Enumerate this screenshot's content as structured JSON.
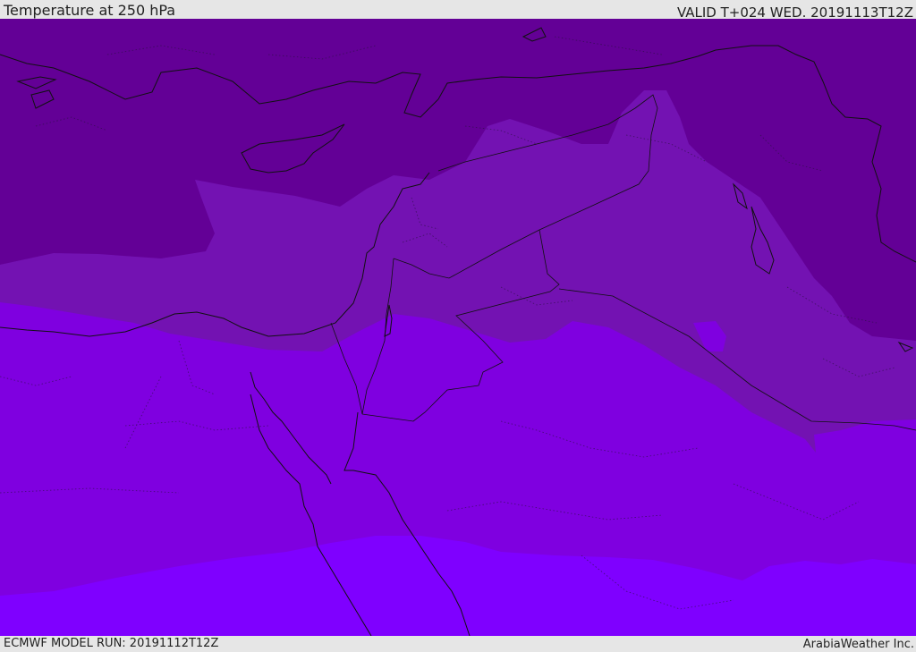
{
  "header": {
    "title": "Temperature at 250 hPa",
    "valid": "VALID T+024 WED. 20191113T12Z"
  },
  "footer": {
    "model_run": "ECMWF MODEL RUN: 20191112T12Z",
    "credit": "ArabiaWeather Inc."
  },
  "map": {
    "region": "Eastern Mediterranean / Levant / Middle East",
    "colors": {
      "band_coldest": "#630096",
      "band_cold": "#7312b2",
      "band_mid": "#7f00e0",
      "band_warm": "#7f00ff",
      "lines": "#111111"
    }
  }
}
